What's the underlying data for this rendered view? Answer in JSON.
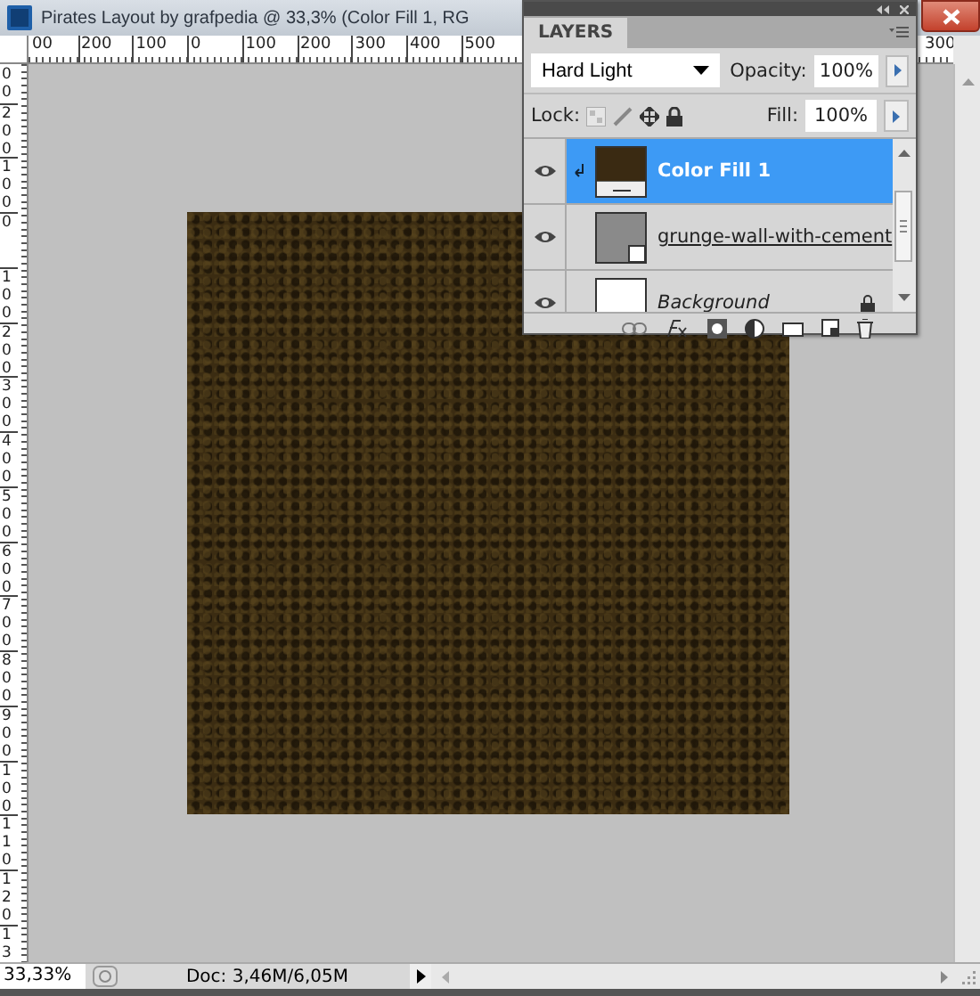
{
  "window": {
    "title": "Pirates Layout by grafpedia @ 33,3% (Color Fill 1, RG"
  },
  "ruler_top": {
    "labels": [
      "00",
      "200",
      "100",
      "0",
      "100",
      "200",
      "300",
      "400",
      "500"
    ],
    "edge_label": "300"
  },
  "ruler_left": {
    "labels": [
      "00",
      "200",
      "100",
      "0",
      "100",
      "200",
      "300",
      "400",
      "500",
      "600",
      "700",
      "800",
      "900",
      "100",
      "110",
      "120",
      "13"
    ]
  },
  "layers_panel": {
    "tab": "LAYERS",
    "blend_mode": "Hard Light",
    "opacity_label": "Opacity:",
    "opacity": "100%",
    "lock_label": "Lock:",
    "fill_label": "Fill:",
    "fill": "100%",
    "layers": [
      {
        "name": "Color Fill 1",
        "kind": "fill",
        "selected": true,
        "visible": true,
        "locked": false,
        "clipped": true
      },
      {
        "name": "grunge-wall-with-cement",
        "kind": "smart",
        "selected": false,
        "visible": true,
        "locked": false,
        "clipped": false
      },
      {
        "name": "Background",
        "kind": "background",
        "selected": false,
        "visible": true,
        "locked": true,
        "clipped": false
      }
    ]
  },
  "status_bar": {
    "zoom": "33,33%",
    "doc_info": "Doc: 3,46M/6,05M"
  }
}
